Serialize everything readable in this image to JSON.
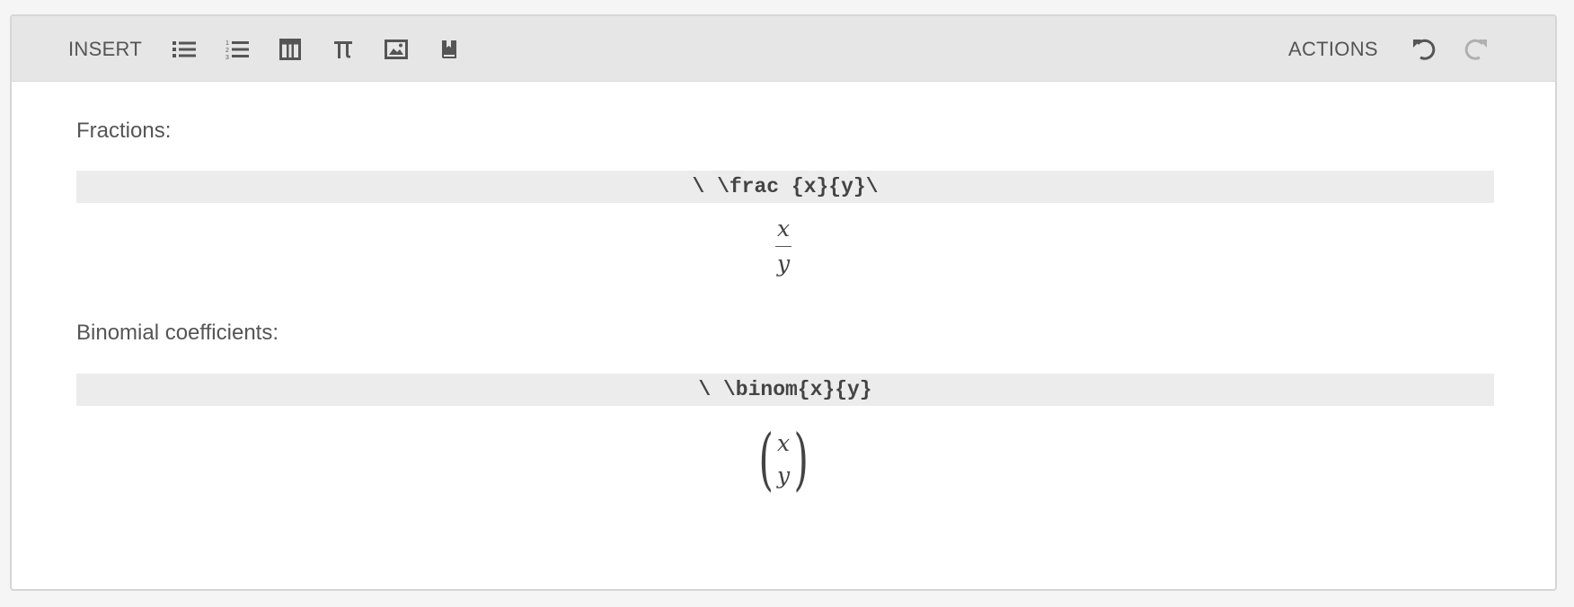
{
  "toolbar": {
    "insert_label": "INSERT",
    "actions_label": "ACTIONS",
    "insert_buttons": [
      {
        "name": "bulleted-list-icon"
      },
      {
        "name": "numbered-list-icon"
      },
      {
        "name": "table-icon"
      },
      {
        "name": "math-pi-icon"
      },
      {
        "name": "image-icon"
      },
      {
        "name": "bookmark-icon"
      }
    ],
    "action_buttons": [
      {
        "name": "undo-icon",
        "enabled": true
      },
      {
        "name": "redo-icon",
        "enabled": false
      }
    ]
  },
  "sections": [
    {
      "label": "Fractions:",
      "code": "\\ \\frac {x}{y}\\",
      "rendered": {
        "type": "fraction",
        "numerator": "x",
        "denominator": "y"
      }
    },
    {
      "label": "Binomial coefficients:",
      "code": "\\ \\binom{x}{y}",
      "rendered": {
        "type": "binomial",
        "top": "x",
        "bottom": "y"
      }
    }
  ],
  "colors": {
    "toolbar_bg": "#e6e6e6",
    "code_bg": "#ececec",
    "text": "#555555",
    "disabled_icon": "#b0b0b0"
  }
}
